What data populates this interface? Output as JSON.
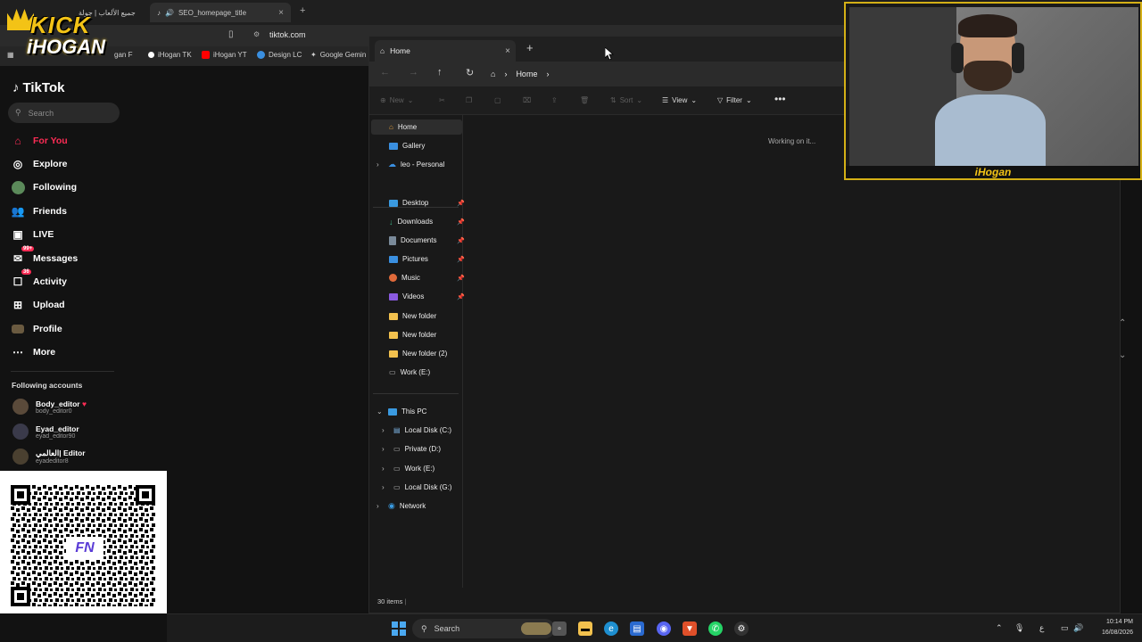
{
  "browser": {
    "tabs": [
      {
        "label": "جميع الألعاب | جولة",
        "active": false
      },
      {
        "label": "SEO_homepage_title",
        "active": true
      }
    ],
    "address": "tiktok.com",
    "bookmarks": [
      "gan F",
      "iHogan TK",
      "iHogan YT",
      "Design LC",
      "Google Gemin"
    ]
  },
  "logo": {
    "line1": "KICK",
    "line2": "iHOGAN"
  },
  "tiktok": {
    "brand": "TikTok",
    "search_placeholder": "Search",
    "nav": [
      {
        "label": "For You",
        "icon": "home-icon",
        "active": true
      },
      {
        "label": "Explore",
        "icon": "compass-icon"
      },
      {
        "label": "Following",
        "icon": "following-icon"
      },
      {
        "label": "Friends",
        "icon": "friends-icon"
      },
      {
        "label": "LIVE",
        "icon": "live-icon"
      },
      {
        "label": "Messages",
        "icon": "messages-icon",
        "badge": "99+"
      },
      {
        "label": "Activity",
        "icon": "activity-icon",
        "badge": "36"
      },
      {
        "label": "Upload",
        "icon": "upload-icon"
      },
      {
        "label": "Profile",
        "icon": "profile-icon"
      },
      {
        "label": "More",
        "icon": "more-icon"
      }
    ],
    "following_heading": "Following accounts",
    "accounts": [
      {
        "name": "Body_editor",
        "handle": "body_editor0"
      },
      {
        "name": "Eyad_editor",
        "handle": "eyad_editor90"
      },
      {
        "name": "العالمي| Editor",
        "handle": "eyadeditor8"
      }
    ]
  },
  "qr": {
    "logo_text": "FN"
  },
  "explorer": {
    "tab_title": "Home",
    "breadcrumb": "Home",
    "commands": {
      "new": "New",
      "sort": "Sort",
      "view": "View",
      "filter": "Filter"
    },
    "nav_top": [
      "Home",
      "Gallery",
      "leo - Personal"
    ],
    "nav_pinned": [
      "Desktop",
      "Downloads",
      "Documents",
      "Pictures",
      "Music",
      "Videos"
    ],
    "nav_folders": [
      "New folder",
      "New folder",
      "New folder (2)",
      "Work (E:)"
    ],
    "this_pc": "This PC",
    "drives": [
      "Local Disk (C:)",
      "Private (D:)",
      "Work (E:)",
      "Local Disk (G:)"
    ],
    "network": "Network",
    "working_text": "Working on it...",
    "status": "30 items"
  },
  "webcam": {
    "name": "iHogan"
  },
  "taskbar": {
    "search": "Search",
    "time": "10:14 PM",
    "date": "16/08/2026",
    "lang": "ع"
  }
}
